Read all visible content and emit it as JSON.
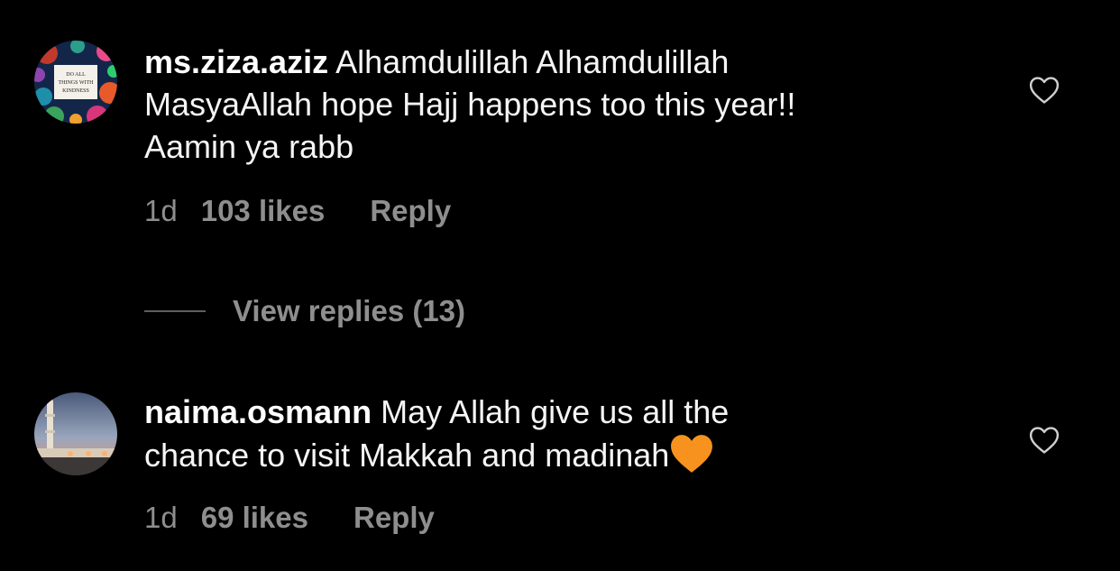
{
  "comments": [
    {
      "username": "ms.ziza.aziz",
      "text_line1": " Alhamdulillah Alhamdulillah",
      "text_line2": "MasyaAllah hope Hajj happens too this year!!",
      "text_line3": "Aamin ya rabb",
      "age": "1d",
      "likes": "103 likes",
      "reply": "Reply",
      "avatar_text": [
        "DO ALL",
        "THINGS WITH",
        "KINDNESS"
      ],
      "avatar_icon": "floral-kindness-avatar",
      "like_icon": "heart-outline-icon"
    },
    {
      "username": "naima.osmann",
      "text_line1": " May Allah give us all the",
      "text_line2": "chance to visit Makkah and madinah",
      "emoji": "orange-heart-emoji",
      "age": "1d",
      "likes": "69 likes",
      "reply": "Reply",
      "avatar_icon": "mosque-photo-avatar",
      "like_icon": "heart-outline-icon"
    }
  ],
  "view_replies": "View replies (13)",
  "colors": {
    "background": "#000000",
    "primary_text": "#ffffff",
    "secondary_text": "#8e8e8e",
    "emoji_orange": "#f7921e"
  }
}
